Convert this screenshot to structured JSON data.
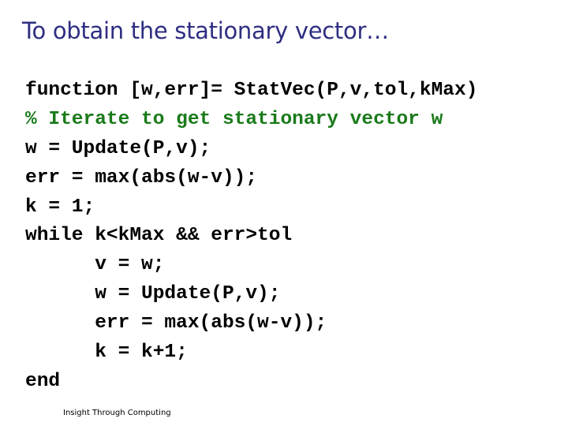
{
  "slide": {
    "title": "To obtain the stationary vector…",
    "footer": "Insight Through Computing",
    "colors": {
      "title": "#2e2e82",
      "code": "#000000",
      "comment": "#1a7a1a"
    }
  },
  "code": {
    "lines": [
      {
        "text": "function [w,err]= StatVec(P,v,tol,kMax)",
        "kind": "code"
      },
      {
        "text": "% Iterate to get stationary vector w",
        "kind": "comment"
      },
      {
        "text": "w = Update(P,v);",
        "kind": "code"
      },
      {
        "text": "err = max(abs(w-v));",
        "kind": "code"
      },
      {
        "text": "k = 1;",
        "kind": "code"
      },
      {
        "text": "while k<kMax && err>tol",
        "kind": "code"
      },
      {
        "text": "      v = w;",
        "kind": "code"
      },
      {
        "text": "      w = Update(P,v);",
        "kind": "code"
      },
      {
        "text": "      err = max(abs(w-v));",
        "kind": "code"
      },
      {
        "text": "      k = k+1;",
        "kind": "code"
      },
      {
        "text": "end",
        "kind": "code"
      }
    ]
  }
}
